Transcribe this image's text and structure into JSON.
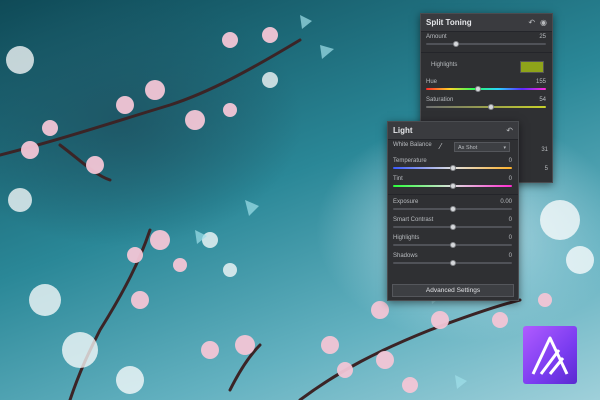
{
  "split_toning": {
    "title": "Split Toning",
    "amount": {
      "label": "Amount",
      "value": "25",
      "level": 0.25
    },
    "highlights": {
      "label": "Highlights",
      "color": "#8fa41a"
    },
    "hue": {
      "label": "Hue",
      "value": "155",
      "level": 0.43
    },
    "saturation": {
      "label": "Saturation",
      "value": "54",
      "level": 0.54
    },
    "extra_value_1": "31",
    "extra_value_2": "5"
  },
  "light": {
    "title": "Light",
    "white_balance": {
      "label": "White Balance",
      "selected": "As Shot"
    },
    "temperature": {
      "label": "Temperature",
      "value": "0",
      "level": 0.5
    },
    "tint": {
      "label": "Tint",
      "value": "0",
      "level": 0.5
    },
    "exposure": {
      "label": "Exposure",
      "value": "0.00",
      "level": 0.5
    },
    "smart_contrast": {
      "label": "Smart Contrast",
      "value": "0",
      "level": 0.5
    },
    "highlights": {
      "label": "Highlights",
      "value": "0",
      "level": 0.5
    },
    "shadows": {
      "label": "Shadows",
      "value": "0",
      "level": 0.5
    },
    "advanced_button": "Advanced Settings"
  },
  "icons": {
    "reset": "reset-icon",
    "visibility": "eye-icon",
    "picker": "eyedropper-icon",
    "logo": "affinity-photo-logo"
  }
}
